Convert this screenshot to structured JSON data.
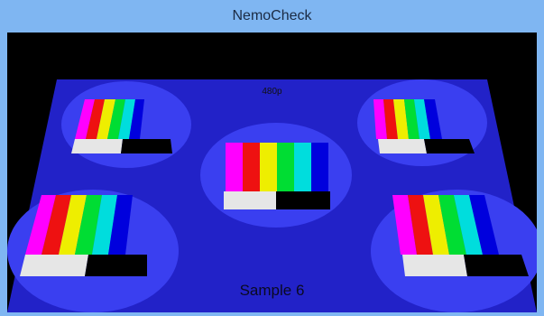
{
  "window": {
    "title": "NemoCheck"
  },
  "scene": {
    "resolution_label": "480p",
    "sample_label": "Sample 6",
    "colors": {
      "board": "#2222c8",
      "circle": "#3a3ff0",
      "bars": [
        "#ff00ff",
        "#ee1111",
        "#eeee00",
        "#00dd33",
        "#00dddd",
        "#0000dd"
      ],
      "white_block": "#e6e6e6",
      "black_block": "#000000"
    }
  }
}
